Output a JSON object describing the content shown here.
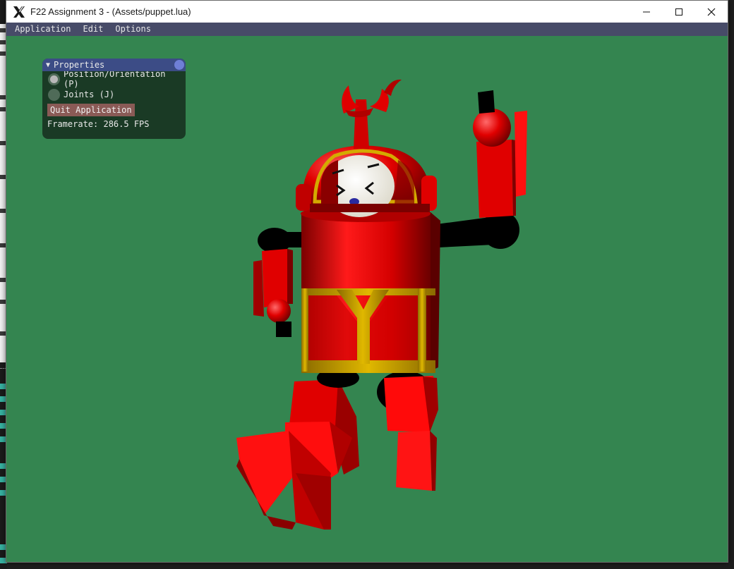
{
  "window": {
    "title": "F22 Assignment 3 - (Assets/puppet.lua)",
    "controls": [
      "minimize-icon",
      "maximize-icon",
      "close-icon"
    ]
  },
  "menubar": {
    "items": [
      "Application",
      "Edit",
      "Options"
    ]
  },
  "properties_panel": {
    "title": "Properties",
    "mode_options": [
      {
        "label": "Position/Orientation (P)",
        "selected": true
      },
      {
        "label": "Joints (J)",
        "selected": false
      }
    ],
    "quit_label": "Quit Application",
    "framerate_text": "Framerate: 286.5 FPS"
  },
  "scene": {
    "background_color": "#348550",
    "puppet_primary_color": "#e00000",
    "puppet_trim_color": "#d4aa00",
    "joint_color": "#000000",
    "face_color": "#f2efe3",
    "nose_color": "#2a2aa0"
  }
}
